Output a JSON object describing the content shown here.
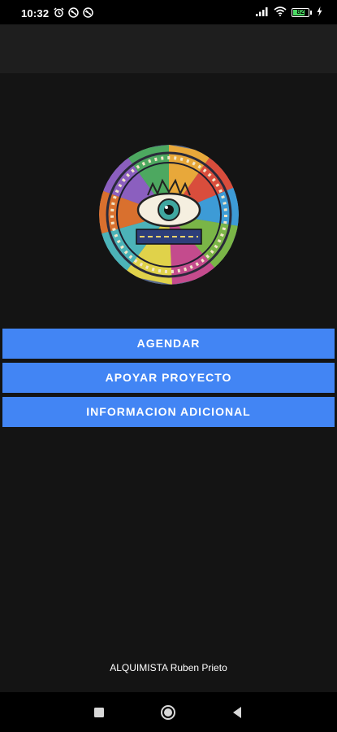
{
  "status_bar": {
    "time": "10:32",
    "left_icons": [
      "alarm-icon",
      "do-not-disturb-icon",
      "do-not-disturb-icon"
    ],
    "right_icons": [
      "signal-icon",
      "wifi-icon",
      "battery-icon",
      "charging-icon"
    ],
    "battery_level": "82",
    "battery_color": "#4cd964"
  },
  "main": {
    "logo_icon": "circular-mandala-eye-logo",
    "buttons": [
      {
        "label": "AGENDAR"
      },
      {
        "label": "APOYAR PROYECTO"
      },
      {
        "label": "INFORMACION ADICIONAL"
      }
    ],
    "footer": "ALQUIMISTA Ruben Prieto"
  },
  "nav_bar": {
    "icons": [
      "recents-icon",
      "home-icon",
      "back-icon"
    ]
  },
  "colors": {
    "accent": "#4285f4",
    "background": "#141414",
    "app_bar": "#1e1e1e"
  }
}
